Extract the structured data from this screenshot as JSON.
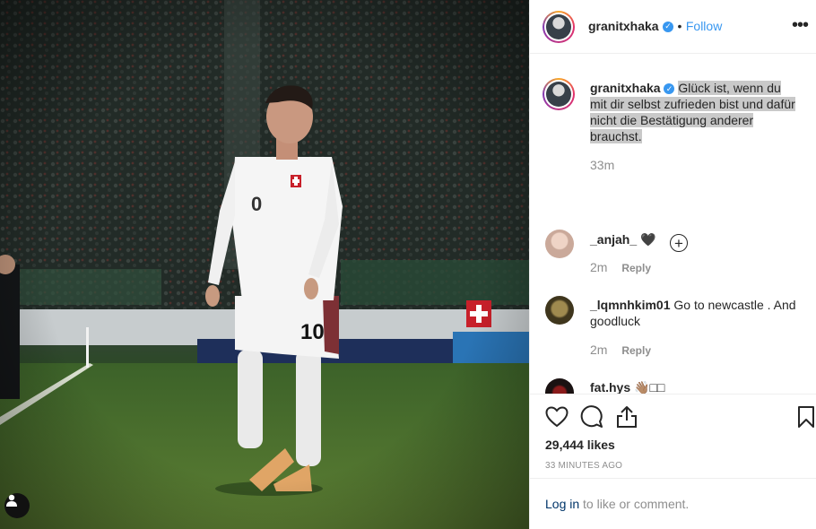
{
  "post": {
    "username": "granitxhaka",
    "follow_separator": "•",
    "follow_label": "Follow",
    "more_icon": "ellipsis-icon",
    "verified_icon": "verified-badge-icon",
    "user_tag_icon": "user-tag-icon"
  },
  "photo": {
    "jersey_number_shirt": "10",
    "jersey_number_chest": "0"
  },
  "caption": {
    "username": "granitxhaka",
    "text": "Glück ist, wenn du mit dir selbst zufrieden bist und dafür nicht die Bestätigung anderer brauchst.",
    "time": "33m",
    "load_more_icon": "plus-circle-icon"
  },
  "comments": [
    {
      "username": "_anjah_",
      "text": "🖤",
      "time": "2m",
      "reply_label": "Reply"
    },
    {
      "username": "_lqmnhkim01",
      "text": "Go to newcastle . And goodluck",
      "time": "2m",
      "reply_label": "Reply"
    },
    {
      "username": "fat.hys",
      "text": "👋🏽□□",
      "time": "",
      "reply_label": ""
    }
  ],
  "actions": {
    "like_icon": "heart-icon",
    "comment_icon": "comment-icon",
    "share_icon": "share-icon",
    "save_icon": "bookmark-icon",
    "likes": "29,444 likes",
    "timestamp": "33 MINUTES AGO"
  },
  "login": {
    "link_label": "Log in",
    "rest_text": "to like or comment."
  },
  "colors": {
    "accent": "#3897f0",
    "text": "#262626",
    "muted": "#8e8e8e",
    "highlight": "#c9c9c9",
    "link_dark": "#003569"
  }
}
